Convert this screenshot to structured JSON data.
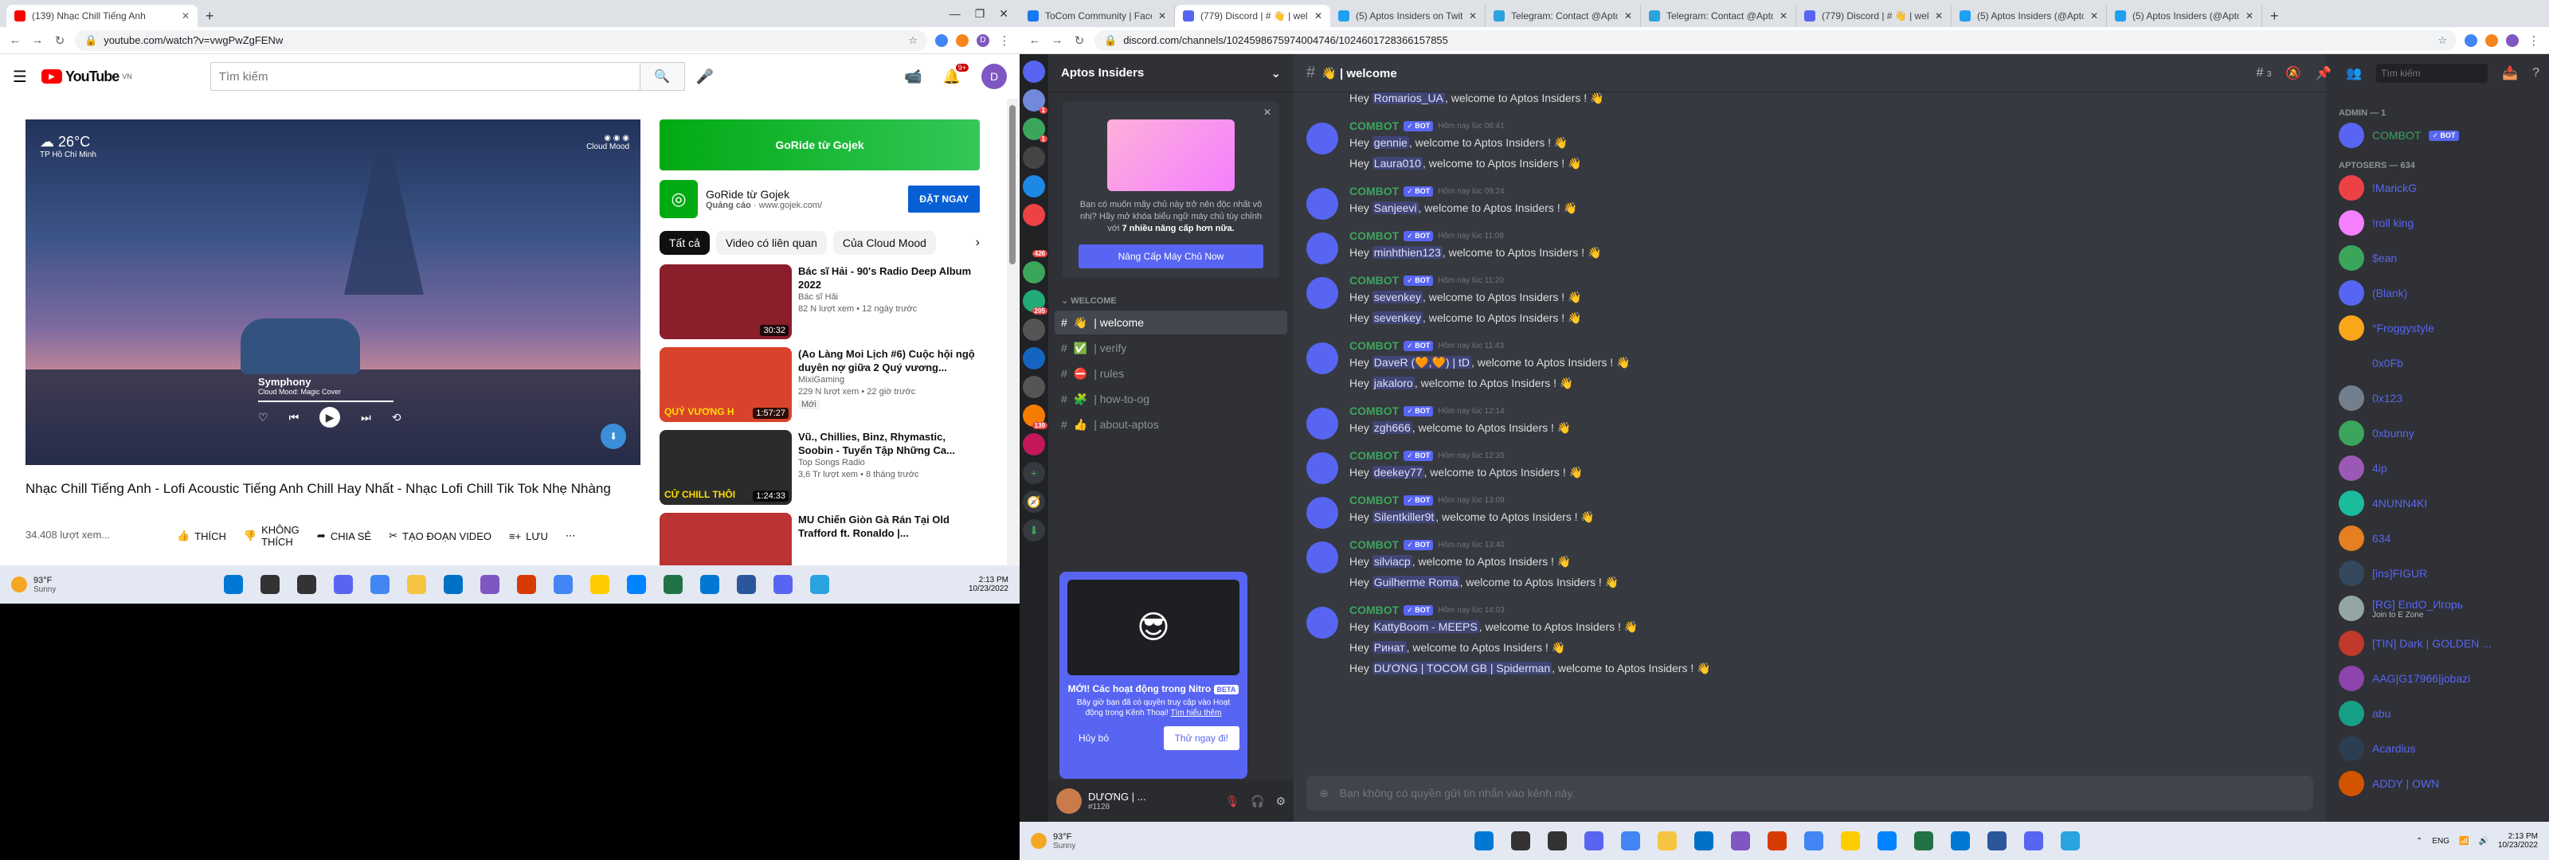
{
  "left_browser": {
    "tabs": [
      {
        "title": "(139) Nhạc Chill Tiếng Anh"
      }
    ],
    "url": "youtube.com/watch?v=vwgPwZgFENw"
  },
  "youtube": {
    "logo": "YouTube",
    "region": "VN",
    "search_placeholder": "Tìm kiếm",
    "notif_count": "9+",
    "avatar": "D",
    "player": {
      "weather_temp": "26°C",
      "weather_city": "TP Hồ Chí Minh",
      "brand": "Cloud Mood",
      "song": "Symphony",
      "song_sub": "Cloud Mood: Magic Cover"
    },
    "video_title": "Nhạc Chill Tiếng Anh - Lofi Acoustic Tiếng Anh Chill Hay Nhất - Nhạc Lofi Chill Tik Tok Nhẹ Nhàng",
    "views": "34.408 lượt xem...",
    "actions": [
      "THÍCH",
      "KHÔNG THÍCH",
      "CHIA SẺ",
      "TẠO ĐOẠN VIDEO",
      "LƯU"
    ],
    "ad": {
      "banner": "GoRide từ Gojek",
      "title": "GoRide từ Gojek",
      "sponsor": "Quảng cáo",
      "domain": "www.gojek.com/",
      "cta": "ĐẶT NGAY"
    },
    "chips": [
      "Tất cả",
      "Video có liên quan",
      "Của Cloud Mood"
    ],
    "recs": [
      {
        "title": "Bác sĩ Hải - 90's Radio Deep Album 2022",
        "channel": "Bác sĩ Hải",
        "meta": "82 N lượt xem • 12 ngày trước",
        "dur": "30:32",
        "color": "#8a1e2a"
      },
      {
        "title": "(Ao Làng Moi Lịch #6) Cuộc hội ngộ duyên nợ giữa 2 Quý vương...",
        "channel": "MixiGaming",
        "meta": "229 N lượt xem • 22 giờ trước",
        "badge": "Mới",
        "dur": "1:57:27",
        "thumb_text": "QUÝ VƯƠNG H",
        "color": "#d9432b"
      },
      {
        "title": "Vũ., Chillies, Binz, Rhymastic, Soobin - Tuyển Tập Những Ca...",
        "channel": "Top Songs Radio",
        "meta": "3,6 Tr lượt xem • 8 tháng trước",
        "dur": "1:24:33",
        "thumb_text": "CỬ CHILL THÔI",
        "color": "#2b2b2b"
      },
      {
        "title": "MU Chiến Giòn Gà Rán Tại Old Trafford ft. Ronaldo |...",
        "channel": "",
        "meta": "",
        "dur": "",
        "color": "#b33"
      }
    ]
  },
  "left_taskbar": {
    "temp": "93°F",
    "weather": "Sunny",
    "time": "2:13 PM",
    "date": "10/23/2022"
  },
  "right_browser": {
    "tabs": [
      {
        "title": "ToCom Community | Faceb"
      },
      {
        "title": "(779) Discord | # 👋 | welco"
      },
      {
        "title": "(5) Aptos Insiders on Twitt"
      },
      {
        "title": "Telegram: Contact @Apto"
      },
      {
        "title": "Telegram: Contact @Apto"
      },
      {
        "title": "(779) Discord | # 👋 | welc"
      },
      {
        "title": "(5) Aptos Insiders (@Apto"
      },
      {
        "title": "(5) Aptos Insiders (@Apto"
      }
    ],
    "url": "discord.com/channels/1024598675974004746/1024601728366157855"
  },
  "discord": {
    "server": "Aptos Insiders",
    "channel_header": "👋 | welcome",
    "search": "Tìm kiếm",
    "thread_count": "3",
    "promo": {
      "body": "Bạn có muốn mấy chủ này trở nên độc nhất vô nhị? Hãy mở khóa biểu ngữ máy chủ tùy chỉnh với ",
      "strong": "7 nhiều năng cấp hơn nữa.",
      "button": "Nâng Cấp Máy Chủ Now"
    },
    "category": "WELCOME",
    "channels": [
      {
        "emoji": "👋",
        "name": "| welcome",
        "selected": true
      },
      {
        "emoji": "✅",
        "name": "| verify"
      },
      {
        "emoji": "⛔",
        "name": "| rules"
      },
      {
        "emoji": "🧩",
        "name": "| how-to-og"
      },
      {
        "emoji": "👍",
        "name": "| about-aptos"
      }
    ],
    "nitro": {
      "title": "MỚI! Các hoạt động trong Nitro",
      "beta": "BETA",
      "body": "Bây giờ bạn đã có quyền truy cập vào Hoạt động trong Kênh Thoại! ",
      "link": "Tìm hiểu thêm",
      "dismiss": "Hủy bỏ",
      "try": "Thử ngay đi!"
    },
    "user": {
      "name": "DƯƠNG | ...",
      "tag": "#1128"
    },
    "messages": [
      {
        "author": "COMBOT",
        "time": "Hôm nay lúc 08:41",
        "lines": [
          "gennie",
          "Laura010"
        ]
      },
      {
        "author": "COMBOT",
        "time": "Hôm nay lúc 09:24",
        "lines": [
          "Sanjeevi"
        ]
      },
      {
        "author": "COMBOT",
        "time": "Hôm nay lúc 11:08",
        "lines": [
          "minhthien123"
        ]
      },
      {
        "author": "COMBOT",
        "time": "Hôm nay lúc 11:20",
        "lines": [
          "sevenkey",
          "sevenkey"
        ]
      },
      {
        "author": "COMBOT",
        "time": "Hôm nay lúc 11:43",
        "lines": [
          "DaveR (🧡,🧡) | tD",
          "jakaloro"
        ]
      },
      {
        "author": "COMBOT",
        "time": "Hôm nay lúc 12:14",
        "lines": [
          "zgh666"
        ]
      },
      {
        "author": "COMBOT",
        "time": "Hôm nay lúc 12:35",
        "lines": [
          "deekey77"
        ]
      },
      {
        "author": "COMBOT",
        "time": "Hôm nay lúc 13:09",
        "lines": [
          "Silentkiller9t"
        ]
      },
      {
        "author": "COMBOT",
        "time": "Hôm nay lúc 13:40",
        "lines": [
          "silviacp",
          "Guilherme Roma"
        ]
      },
      {
        "author": "COMBOT",
        "time": "Hôm nay lúc 14:03",
        "lines": [
          "KattyBoom - MEEPS",
          "Ринат",
          "DƯƠNG | TOCOM GB | Spiderman"
        ]
      }
    ],
    "top_line": "Romarios_UA",
    "hey": "Hey",
    "welcome_suffix": ", welcome to Aptos Insiders !",
    "input_placeholder": "Bạn không có quyền gửi tin nhắn vào kênh này.",
    "admin_header": "ADMIN — 1",
    "admin": "COMBOT",
    "members_header": "APTOSERS — 634",
    "members": [
      "!MarickG",
      "!roll king",
      "$ean",
      "(Blank)",
      "°Froggystyle",
      "0x0Fb",
      "0x123",
      "0xbunny",
      "4ip",
      "4NUNN4KI",
      "634",
      "[ins]FIGUR",
      "[RG] EndO_Игорь",
      "[TIN] Dark | GOLDEN ...",
      "AAG|G17966|jobazi",
      "abu",
      "Acardius",
      "ADDY | OWN"
    ],
    "member_status": "Join to E Zone"
  },
  "right_taskbar": {
    "temp": "93°F",
    "weather": "Sunny",
    "lang": "ENG",
    "time": "2:13 PM",
    "date": "10/23/2022"
  }
}
